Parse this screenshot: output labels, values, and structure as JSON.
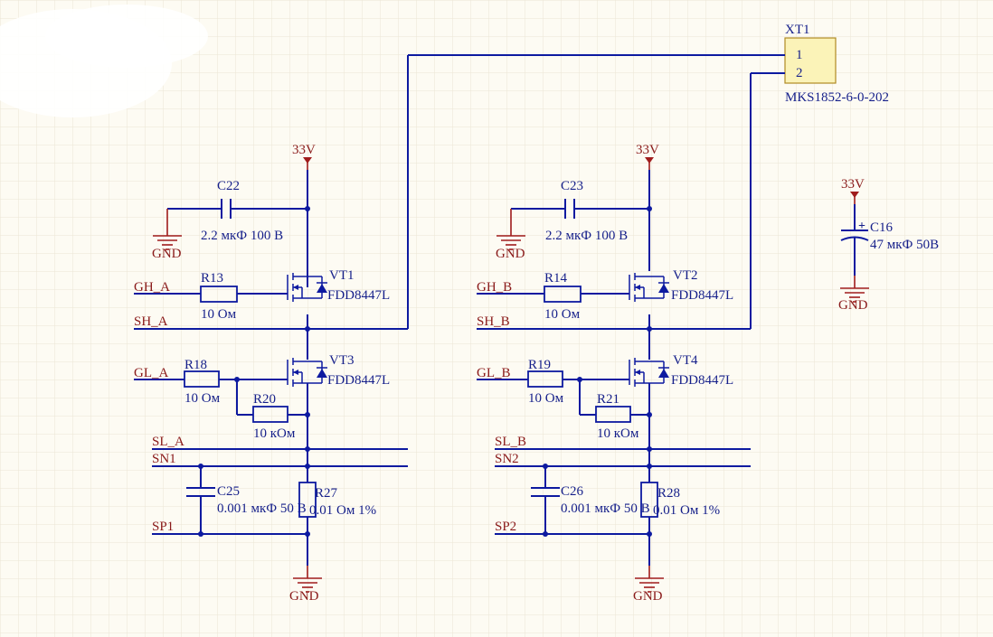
{
  "connector": {
    "ref": "XT1",
    "pins": [
      "1",
      "2"
    ],
    "part": "MKS1852-6-0-202"
  },
  "power": {
    "vcc": "33V",
    "gnd": "GND"
  },
  "halfbridge_a": {
    "in_high": "GH_A",
    "in_low": "GL_A",
    "switch_node": "SH_A",
    "low_sense": "SL_A",
    "sense_n": "SN1",
    "sense_p": "SP1",
    "cap_boot": {
      "ref": "C22",
      "value": "2.2 мкФ 100 В"
    },
    "r_gate_high": {
      "ref": "R13",
      "value": "10 Ом"
    },
    "q_high": {
      "ref": "VT1",
      "part": "FDD8447L"
    },
    "q_low": {
      "ref": "VT3",
      "part": "FDD8447L"
    },
    "r_gate_low": {
      "ref": "R18",
      "value": "10 Ом"
    },
    "r_pulldown": {
      "ref": "R20",
      "value": "10 кОм"
    },
    "cap_sense": {
      "ref": "C25",
      "value": "0.001 мкФ 50 В"
    },
    "r_shunt": {
      "ref": "R27",
      "value": "0.01 Ом 1%"
    }
  },
  "halfbridge_b": {
    "in_high": "GH_B",
    "in_low": "GL_B",
    "switch_node": "SH_B",
    "low_sense": "SL_B",
    "sense_n": "SN2",
    "sense_p": "SP2",
    "cap_boot": {
      "ref": "C23",
      "value": "2.2 мкФ 100 В"
    },
    "r_gate_high": {
      "ref": "R14",
      "value": "10 Ом"
    },
    "q_high": {
      "ref": "VT2",
      "part": "FDD8447L"
    },
    "q_low": {
      "ref": "VT4",
      "part": "FDD8447L"
    },
    "r_gate_low": {
      "ref": "R19",
      "value": "10 Ом"
    },
    "r_pulldown": {
      "ref": "R21",
      "value": "10 кОм"
    },
    "cap_sense": {
      "ref": "C26",
      "value": "0.001 мкФ 50 В"
    },
    "r_shunt": {
      "ref": "R28",
      "value": "0.01 Ом 1%"
    }
  },
  "bulk_cap": {
    "ref": "C16",
    "value": "47 мкФ 50В",
    "polarity": "+"
  },
  "colors": {
    "wire": "#0d1aa0",
    "power_symbol": "#a01c1c",
    "background": "#fdfbf3",
    "grid": "#ece6d4"
  }
}
